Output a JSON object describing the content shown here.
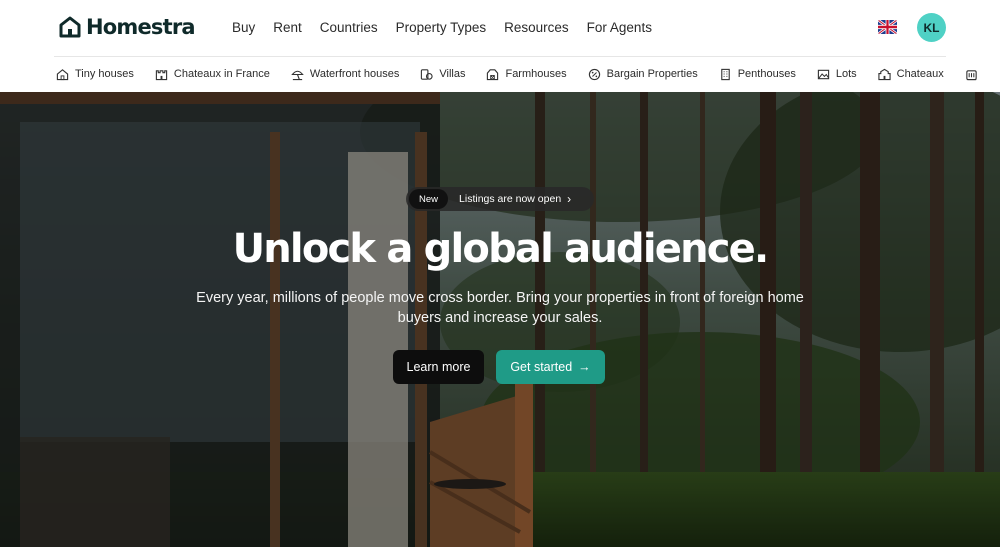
{
  "brand": {
    "name": "Homestra"
  },
  "nav": [
    "Buy",
    "Rent",
    "Countries",
    "Property Types",
    "Resources",
    "For Agents"
  ],
  "user": {
    "initials": "KL",
    "avatar_color": "#4fd1c5"
  },
  "language_icon": "uk-flag-icon",
  "categories": [
    {
      "label": "Tiny houses",
      "icon": "home-icon"
    },
    {
      "label": "Chateaux in France",
      "icon": "castle-icon"
    },
    {
      "label": "Waterfront houses",
      "icon": "beach-umbrella-icon"
    },
    {
      "label": "Villas",
      "icon": "villa-icon"
    },
    {
      "label": "Farmhouses",
      "icon": "farmhouse-icon"
    },
    {
      "label": "Bargain Properties",
      "icon": "discount-icon"
    },
    {
      "label": "Penthouses",
      "icon": "building-icon"
    },
    {
      "label": "Lots",
      "icon": "landscape-icon"
    },
    {
      "label": "Chateaux",
      "icon": "castle-icon"
    }
  ],
  "hero": {
    "badge": "New",
    "announcement": "Listings are now open",
    "headline": "Unlock a global audience.",
    "subtitle": "Every year, millions of people move cross border. Bring your properties in front of foreign home buyers and increase your sales.",
    "learn_more": "Learn more",
    "get_started": "Get started",
    "arrow": "→"
  },
  "colors": {
    "accent": "#1f9b87",
    "dark": "#0d0d0d"
  }
}
